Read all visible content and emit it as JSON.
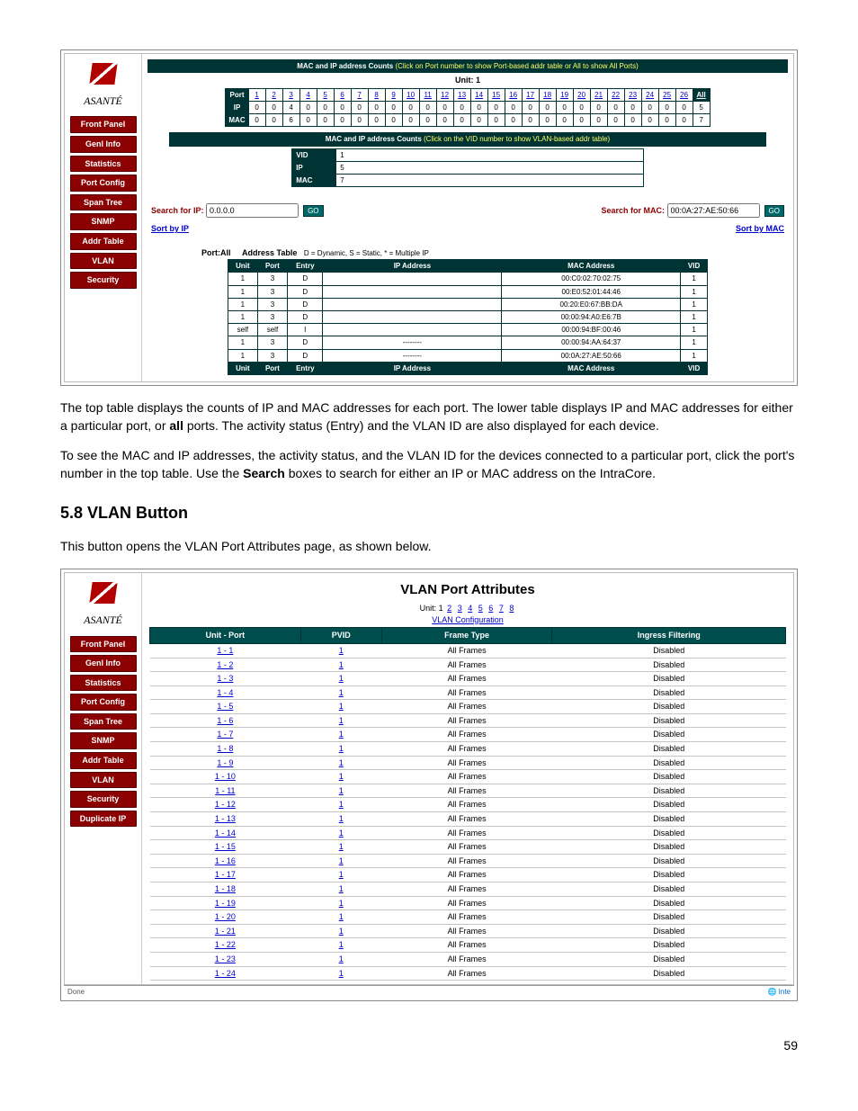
{
  "page_number": "59",
  "para1_a": "The top table displays the counts of IP and MAC addresses for each port. The lower table displays IP and MAC addresses for either a particular port, or ",
  "para1_b": "all",
  "para1_c": " ports. The activity status (Entry) and the VLAN ID are also displayed for each device.",
  "para2_a": "To see the MAC and IP addresses, the activity status, and the VLAN ID for the devices connected to a particular port, click the port's number in the top table. Use the ",
  "para2_b": "Search",
  "para2_c": " boxes to search for either an IP or MAC address on the IntraCore.",
  "heading": "5.8 VLAN Button",
  "para3": "This button opens the VLAN Port Attributes page, as shown below.",
  "brand": "ASANTÉ",
  "nav": [
    "Front Panel",
    "Genl Info",
    "Statistics",
    "Port Config",
    "Span Tree",
    "SNMP",
    "Addr Table",
    "VLAN",
    "Security"
  ],
  "nav2": [
    "Front Panel",
    "Genl Info",
    "Statistics",
    "Port Config",
    "Span Tree",
    "SNMP",
    "Addr Table",
    "VLAN",
    "Security",
    "Duplicate IP"
  ],
  "ss1": {
    "bar1_a": "MAC and IP address Counts",
    "bar1_b": " (Click on Port number to show Port-based addr table or All to show All Ports)",
    "unit": "Unit:  1",
    "port_label": "Port",
    "ip_label": "IP",
    "mac_label": "MAC",
    "all": "All",
    "ports": [
      "1",
      "2",
      "3",
      "4",
      "5",
      "6",
      "7",
      "8",
      "9",
      "10",
      "11",
      "12",
      "13",
      "14",
      "15",
      "16",
      "17",
      "18",
      "19",
      "20",
      "21",
      "22",
      "23",
      "24",
      "25",
      "26"
    ],
    "ip_row": [
      "0",
      "0",
      "4",
      "0",
      "0",
      "0",
      "0",
      "0",
      "0",
      "0",
      "0",
      "0",
      "0",
      "0",
      "0",
      "0",
      "0",
      "0",
      "0",
      "0",
      "0",
      "0",
      "0",
      "0",
      "0",
      "0",
      "5"
    ],
    "mac_row": [
      "0",
      "0",
      "6",
      "0",
      "0",
      "0",
      "0",
      "0",
      "0",
      "0",
      "0",
      "0",
      "0",
      "0",
      "0",
      "0",
      "0",
      "0",
      "0",
      "0",
      "0",
      "0",
      "0",
      "0",
      "0",
      "0",
      "7"
    ],
    "bar2_a": "MAC and IP address Counts",
    "bar2_b": "  (Click on the VID number to show VLAN-based addr table)",
    "vid": "VID",
    "vid_v": "1",
    "ip2": "5",
    "mac2": "7",
    "search_ip_label": "Search for IP:",
    "search_ip_val": "0.0.0.0",
    "go": "GO",
    "search_mac_label": "Search for MAC:",
    "search_mac_val": "00:0A:27:AE:50:66",
    "sort_ip": "Sort by IP",
    "sort_mac": "Sort by MAC",
    "addr_title": "Port:All",
    "addr_heading": "Address Table",
    "addr_legend": "D = Dynamic,  S = Static,   * = Multiple IP",
    "heads": [
      "Unit",
      "Port",
      "Entry",
      "IP Address",
      "MAC Address",
      "VID"
    ],
    "rows": [
      [
        "1",
        "3",
        "D",
        "",
        "00:C0:02:70:02:75",
        "1"
      ],
      [
        "1",
        "3",
        "D",
        "",
        "00:E0:52:01:44:46",
        "1"
      ],
      [
        "1",
        "3",
        "D",
        "",
        "00:20:E0:67:BB:DA",
        "1"
      ],
      [
        "1",
        "3",
        "D",
        "",
        "00:00:94:A0:E6:7B",
        "1"
      ],
      [
        "self",
        "self",
        "I",
        "",
        "00:00:94:BF:00:46",
        "1"
      ],
      [
        "1",
        "3",
        "D",
        "--------",
        "00:00:94:AA:64:37",
        "1"
      ],
      [
        "1",
        "3",
        "D",
        "--------",
        "00:0A:27:AE:50:66",
        "1"
      ]
    ]
  },
  "ss2": {
    "title": "VLAN Port Attributes",
    "unit_prefix": "Unit:  1",
    "units": [
      "2",
      "3",
      "4",
      "5",
      "6",
      "7",
      "8"
    ],
    "vlan_conf": "VLAN Configuration",
    "heads": [
      "Unit - Port",
      "PVID",
      "Frame Type",
      "Ingress Filtering"
    ],
    "row_up_prefix": "1 - ",
    "pvid": "1",
    "ftype": "All Frames",
    "ifilt": "Disabled",
    "port_count": 24,
    "status_done": "Done",
    "status_inet": "Inte"
  }
}
